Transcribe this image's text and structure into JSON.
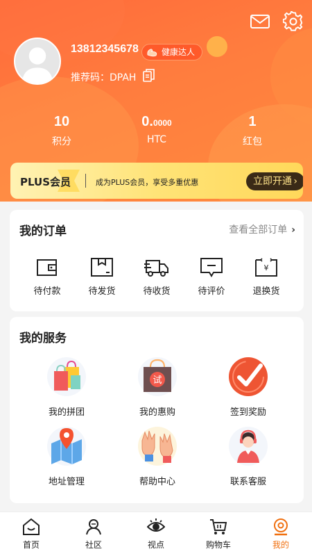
{
  "profile": {
    "phone": "13812345678",
    "badge": "健康达人",
    "referral_label": "推荐码：DPAH"
  },
  "stats": [
    {
      "value": "10",
      "label": "积分"
    },
    {
      "value_main": "0.",
      "value_small": "0000",
      "label": "HTC"
    },
    {
      "value": "1",
      "label": "红包"
    }
  ],
  "plus": {
    "title": "PLUS会员",
    "desc": "成为PLUS会员，享受多重优惠",
    "button": "立即开通",
    "chevron": "›"
  },
  "orders": {
    "title": "我的订单",
    "view_all": "查看全部订单",
    "items": [
      {
        "label": "待付款",
        "icon": "wallet-icon"
      },
      {
        "label": "待发货",
        "icon": "box-icon"
      },
      {
        "label": "待收货",
        "icon": "truck-icon"
      },
      {
        "label": "待评价",
        "icon": "comment-icon"
      },
      {
        "label": "退换货",
        "icon": "return-icon"
      }
    ]
  },
  "services": {
    "title": "我的服务",
    "items": [
      {
        "label": "我的拼团",
        "icon": "shopping-bags-icon"
      },
      {
        "label": "我的惠购",
        "icon": "trial-bag-icon",
        "icon_text": "试"
      },
      {
        "label": "签到奖励",
        "icon": "checkmark-icon"
      },
      {
        "label": "地址管理",
        "icon": "map-pin-icon"
      },
      {
        "label": "帮助中心",
        "icon": "hands-icon"
      },
      {
        "label": "联系客服",
        "icon": "customer-service-icon"
      }
    ]
  },
  "nav": {
    "items": [
      {
        "label": "首页",
        "icon": "home-icon"
      },
      {
        "label": "社区",
        "icon": "community-icon"
      },
      {
        "label": "视点",
        "icon": "eye-icon"
      },
      {
        "label": "购物车",
        "icon": "cart-icon"
      },
      {
        "label": "我的",
        "icon": "profile-icon",
        "active": true
      }
    ]
  },
  "colors": {
    "accent": "#ff7a3c",
    "active_nav": "#f07010",
    "plus_button_bg": "#3a2a17"
  }
}
